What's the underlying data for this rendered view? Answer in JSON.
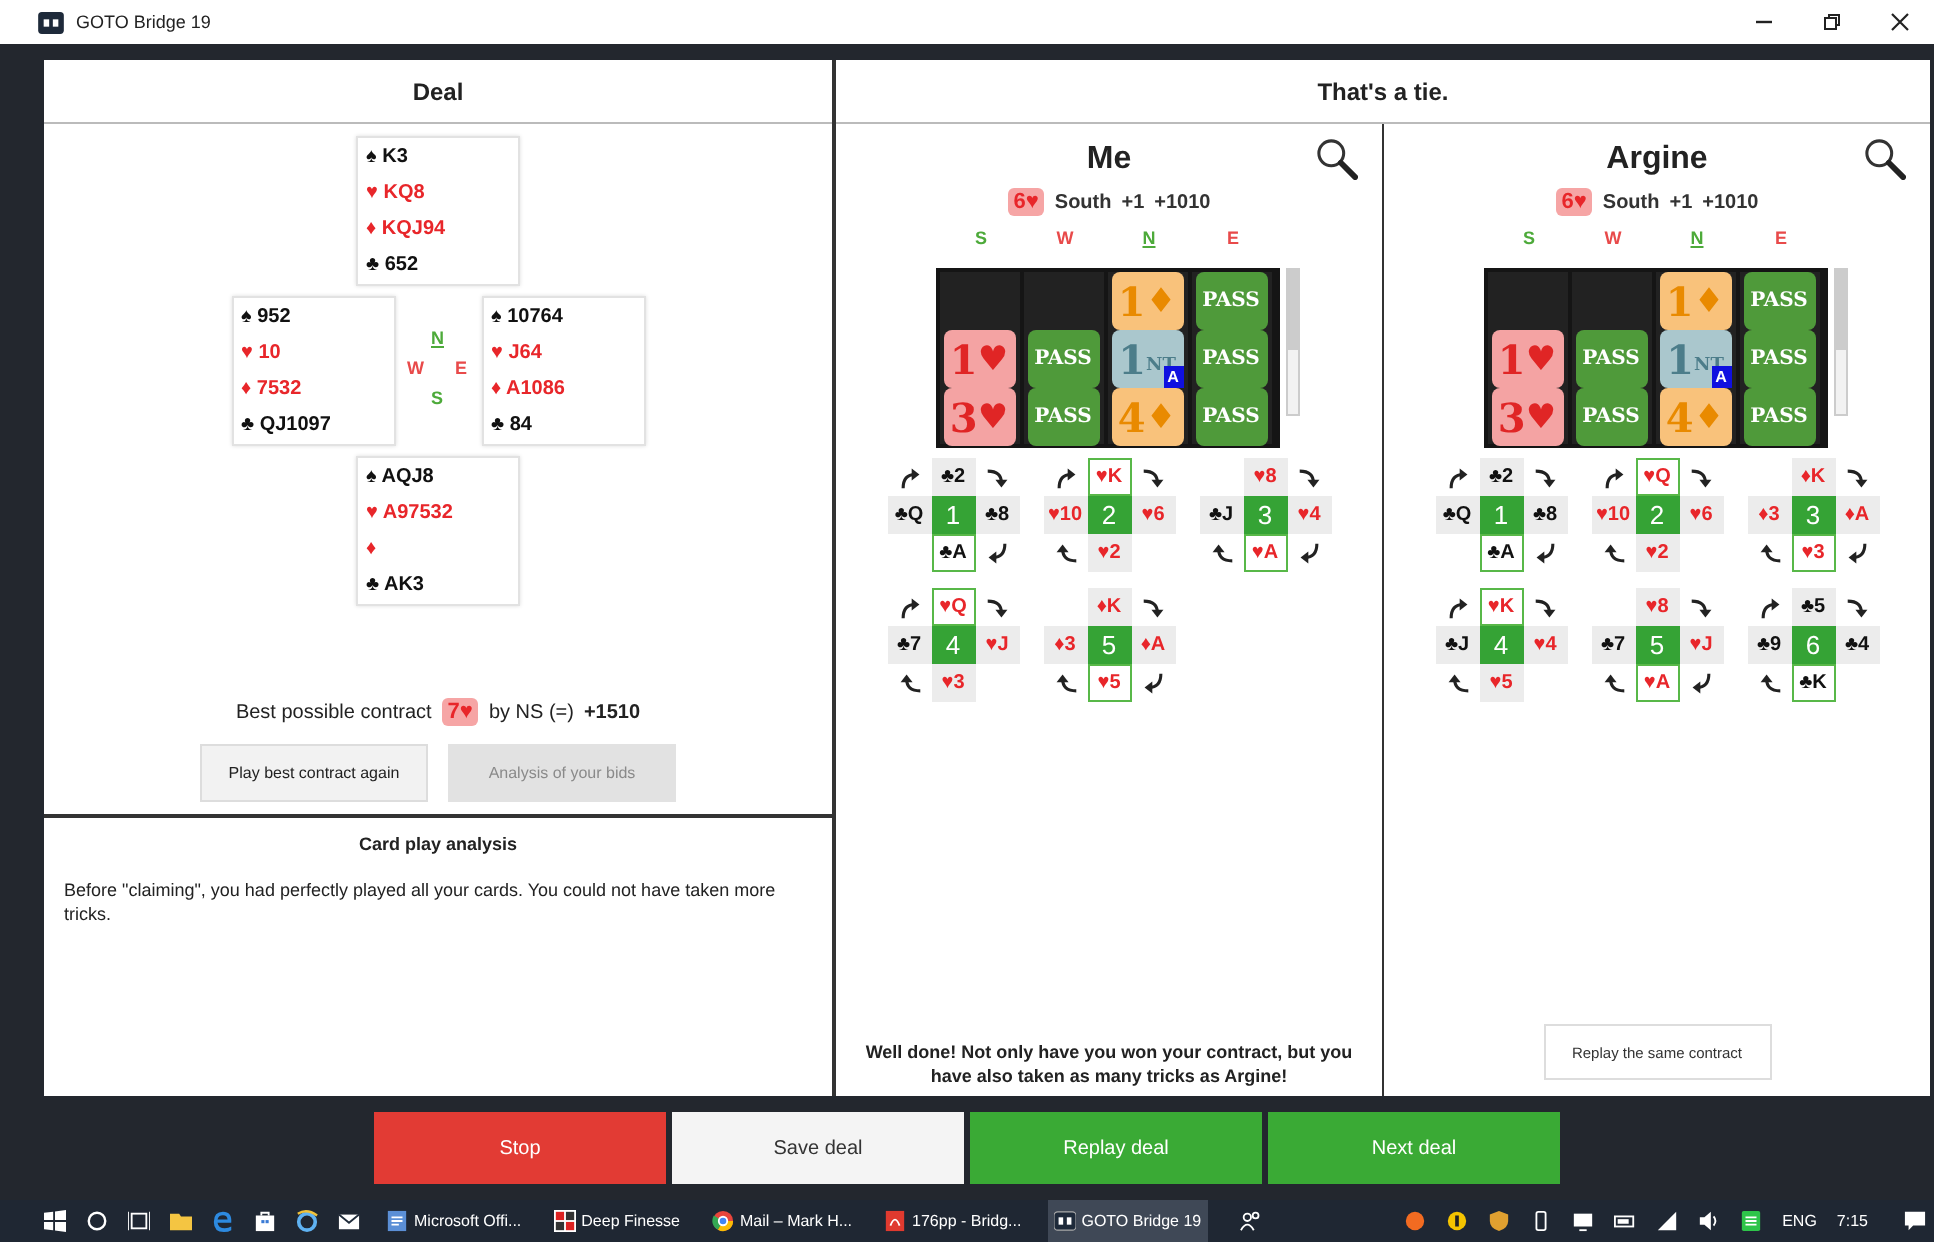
{
  "window": {
    "title": "GOTO Bridge 19"
  },
  "deal": {
    "title": "Deal",
    "hands": [
      {
        "suits": [
          {
            "text": "♠ K3",
            "red": false
          },
          {
            "text": "♥ KQ8",
            "red": true
          },
          {
            "text": "♦ KQJ94",
            "red": true
          },
          {
            "text": "♣ 652",
            "red": false
          }
        ]
      },
      {
        "suits": [
          {
            "text": "♠ 952",
            "red": false
          },
          {
            "text": "♥ 10",
            "red": true
          },
          {
            "text": "♦ 7532",
            "red": true
          },
          {
            "text": "♣ QJ1097",
            "red": false
          }
        ]
      },
      {
        "suits": [
          {
            "text": "♠ 10764",
            "red": false
          },
          {
            "text": "♥ J64",
            "red": true
          },
          {
            "text": "♦ A1086",
            "red": true
          },
          {
            "text": "♣ 84",
            "red": false
          }
        ]
      },
      {
        "suits": [
          {
            "text": "♠ AQJ8",
            "red": false
          },
          {
            "text": "♥ A97532",
            "red": true
          },
          {
            "text": "♦",
            "red": true
          },
          {
            "text": "♣ AK3",
            "red": false
          }
        ]
      }
    ],
    "compass": [
      {
        "label": "N",
        "vulnerable": false,
        "dealer": true
      },
      {
        "label": "W",
        "vulnerable": true,
        "dealer": false
      },
      {
        "label": "E",
        "vulnerable": true,
        "dealer": false
      },
      {
        "label": "S",
        "vulnerable": false,
        "dealer": false
      }
    ],
    "best": {
      "label": "Best possible contract",
      "contract": "7♥",
      "by": "by NS (=)",
      "score": "+1510"
    },
    "buttons": [
      {
        "label": "Play best contract again",
        "disabled": false
      },
      {
        "label": "Analysis of your bids",
        "disabled": true
      }
    ]
  },
  "analysis": {
    "title": "Card play analysis",
    "text": "Before \"claiming\", you had perfectly played all your cards. You could not have taken more tricks."
  },
  "result": {
    "title": "That's a tie."
  },
  "tables": [
    {
      "player": "Me",
      "contract": "6♥",
      "declarer": "South",
      "overtricks": "+1",
      "score": "+1010",
      "columns": [
        {
          "seat": "S",
          "vulnerable": false,
          "dealer": false,
          "bids": [
            {
              "kind": "empty"
            },
            {
              "kind": "heart",
              "rank": "1",
              "strain": "♥"
            },
            {
              "kind": "heart",
              "rank": "3",
              "strain": "♥"
            }
          ]
        },
        {
          "seat": "W",
          "vulnerable": true,
          "dealer": false,
          "bids": [
            {
              "kind": "empty"
            },
            {
              "kind": "pass",
              "strain": "PASS"
            },
            {
              "kind": "pass",
              "strain": "PASS"
            }
          ]
        },
        {
          "seat": "N",
          "vulnerable": false,
          "dealer": true,
          "bids": [
            {
              "kind": "diamond",
              "rank": "1",
              "strain": "♦"
            },
            {
              "kind": "nt",
              "rank": "1",
              "strain": "NT",
              "alert": "A"
            },
            {
              "kind": "diamond",
              "rank": "4",
              "strain": "♦"
            }
          ]
        },
        {
          "seat": "E",
          "vulnerable": true,
          "dealer": false,
          "bids": [
            {
              "kind": "pass",
              "strain": "PASS"
            },
            {
              "kind": "pass",
              "strain": "PASS"
            },
            {
              "kind": "pass",
              "strain": "PASS"
            }
          ]
        }
      ],
      "tricks": [
        {
          "number": "1",
          "cards": [
            {
              "text": "♣2",
              "red": false,
              "won": false,
              "led": false
            },
            {
              "text": "♣Q",
              "red": false,
              "won": false,
              "led": true
            },
            {
              "text": "♣8",
              "red": false,
              "won": false,
              "led": false
            },
            {
              "text": "♣A",
              "red": false,
              "won": true,
              "led": false
            }
          ]
        },
        {
          "number": "2",
          "cards": [
            {
              "text": "♥K",
              "red": true,
              "won": true,
              "led": false
            },
            {
              "text": "♥10",
              "red": true,
              "won": false,
              "led": false
            },
            {
              "text": "♥6",
              "red": true,
              "won": false,
              "led": false
            },
            {
              "text": "♥2",
              "red": true,
              "won": false,
              "led": true
            }
          ]
        },
        {
          "number": "3",
          "cards": [
            {
              "text": "♥8",
              "red": true,
              "won": false,
              "led": true
            },
            {
              "text": "♣J",
              "red": false,
              "won": false,
              "led": false
            },
            {
              "text": "♥4",
              "red": true,
              "won": false,
              "led": false
            },
            {
              "text": "♥A",
              "red": true,
              "won": true,
              "led": false
            }
          ]
        },
        {
          "number": "4",
          "cards": [
            {
              "text": "♥Q",
              "red": true,
              "won": true,
              "led": false
            },
            {
              "text": "♣7",
              "red": false,
              "won": false,
              "led": false
            },
            {
              "text": "♥J",
              "red": true,
              "won": false,
              "led": false
            },
            {
              "text": "♥3",
              "red": true,
              "won": false,
              "led": true
            }
          ]
        },
        {
          "number": "5",
          "cards": [
            {
              "text": "♦K",
              "red": true,
              "won": false,
              "led": true
            },
            {
              "text": "♦3",
              "red": true,
              "won": false,
              "led": false
            },
            {
              "text": "♦A",
              "red": true,
              "won": false,
              "led": false
            },
            {
              "text": "♥5",
              "red": true,
              "won": true,
              "led": false
            }
          ]
        }
      ],
      "message": "Well done! Not only have you won your contract, but you have also taken as many tricks as Argine!"
    },
    {
      "player": "Argine",
      "contract": "6♥",
      "declarer": "South",
      "overtricks": "+1",
      "score": "+1010",
      "columns": [
        {
          "seat": "S",
          "vulnerable": false,
          "dealer": false,
          "bids": [
            {
              "kind": "empty"
            },
            {
              "kind": "heart",
              "rank": "1",
              "strain": "♥"
            },
            {
              "kind": "heart",
              "rank": "3",
              "strain": "♥"
            }
          ]
        },
        {
          "seat": "W",
          "vulnerable": true,
          "dealer": false,
          "bids": [
            {
              "kind": "empty"
            },
            {
              "kind": "pass",
              "strain": "PASS"
            },
            {
              "kind": "pass",
              "strain": "PASS"
            }
          ]
        },
        {
          "seat": "N",
          "vulnerable": false,
          "dealer": true,
          "bids": [
            {
              "kind": "diamond",
              "rank": "1",
              "strain": "♦"
            },
            {
              "kind": "nt",
              "rank": "1",
              "strain": "NT",
              "alert": "A"
            },
            {
              "kind": "diamond",
              "rank": "4",
              "strain": "♦"
            }
          ]
        },
        {
          "seat": "E",
          "vulnerable": true,
          "dealer": false,
          "bids": [
            {
              "kind": "pass",
              "strain": "PASS"
            },
            {
              "kind": "pass",
              "strain": "PASS"
            },
            {
              "kind": "pass",
              "strain": "PASS"
            }
          ]
        }
      ],
      "tricks": [
        {
          "number": "1",
          "cards": [
            {
              "text": "♣2",
              "red": false,
              "won": false,
              "led": false
            },
            {
              "text": "♣Q",
              "red": false,
              "won": false,
              "led": true
            },
            {
              "text": "♣8",
              "red": false,
              "won": false,
              "led": false
            },
            {
              "text": "♣A",
              "red": false,
              "won": true,
              "led": false
            }
          ]
        },
        {
          "number": "2",
          "cards": [
            {
              "text": "♥Q",
              "red": true,
              "won": true,
              "led": false
            },
            {
              "text": "♥10",
              "red": true,
              "won": false,
              "led": false
            },
            {
              "text": "♥6",
              "red": true,
              "won": false,
              "led": false
            },
            {
              "text": "♥2",
              "red": true,
              "won": false,
              "led": true
            }
          ]
        },
        {
          "number": "3",
          "cards": [
            {
              "text": "♦K",
              "red": true,
              "won": false,
              "led": true
            },
            {
              "text": "♦3",
              "red": true,
              "won": false,
              "led": false
            },
            {
              "text": "♦A",
              "red": true,
              "won": false,
              "led": false
            },
            {
              "text": "♥3",
              "red": true,
              "won": true,
              "led": false
            }
          ]
        },
        {
          "number": "4",
          "cards": [
            {
              "text": "♥K",
              "red": true,
              "won": true,
              "led": false
            },
            {
              "text": "♣J",
              "red": false,
              "won": false,
              "led": false
            },
            {
              "text": "♥4",
              "red": true,
              "won": false,
              "led": false
            },
            {
              "text": "♥5",
              "red": true,
              "won": false,
              "led": true
            }
          ]
        },
        {
          "number": "5",
          "cards": [
            {
              "text": "♥8",
              "red": true,
              "won": false,
              "led": true
            },
            {
              "text": "♣7",
              "red": false,
              "won": false,
              "led": false
            },
            {
              "text": "♥J",
              "red": true,
              "won": false,
              "led": false
            },
            {
              "text": "♥A",
              "red": true,
              "won": true,
              "led": false
            }
          ]
        },
        {
          "number": "6",
          "cards": [
            {
              "text": "♣5",
              "red": false,
              "won": false,
              "led": false
            },
            {
              "text": "♣9",
              "red": false,
              "won": false,
              "led": false
            },
            {
              "text": "♣4",
              "red": false,
              "won": false,
              "led": false
            },
            {
              "text": "♣K",
              "red": false,
              "won": true,
              "led": true
            }
          ]
        }
      ],
      "button": "Replay the same contract"
    }
  ],
  "actions": [
    {
      "label": "Stop",
      "kind": "danger"
    },
    {
      "label": "Save deal",
      "kind": "plain"
    },
    {
      "label": "Replay deal",
      "kind": "primary"
    },
    {
      "label": "Next deal",
      "kind": "primary"
    }
  ],
  "taskbar": {
    "apps": [
      {
        "label": "Microsoft Offi...",
        "kind": "document",
        "selected": false
      },
      {
        "label": "Deep Finesse",
        "kind": "grid",
        "selected": false
      },
      {
        "label": "Mail – Mark H...",
        "kind": "browser",
        "selected": false
      },
      {
        "label": "176pp - Bridg...",
        "kind": "pdf",
        "selected": false
      },
      {
        "label": "GOTO Bridge 19",
        "kind": "app",
        "selected": true
      }
    ],
    "language": "ENG",
    "time": "7:15"
  }
}
